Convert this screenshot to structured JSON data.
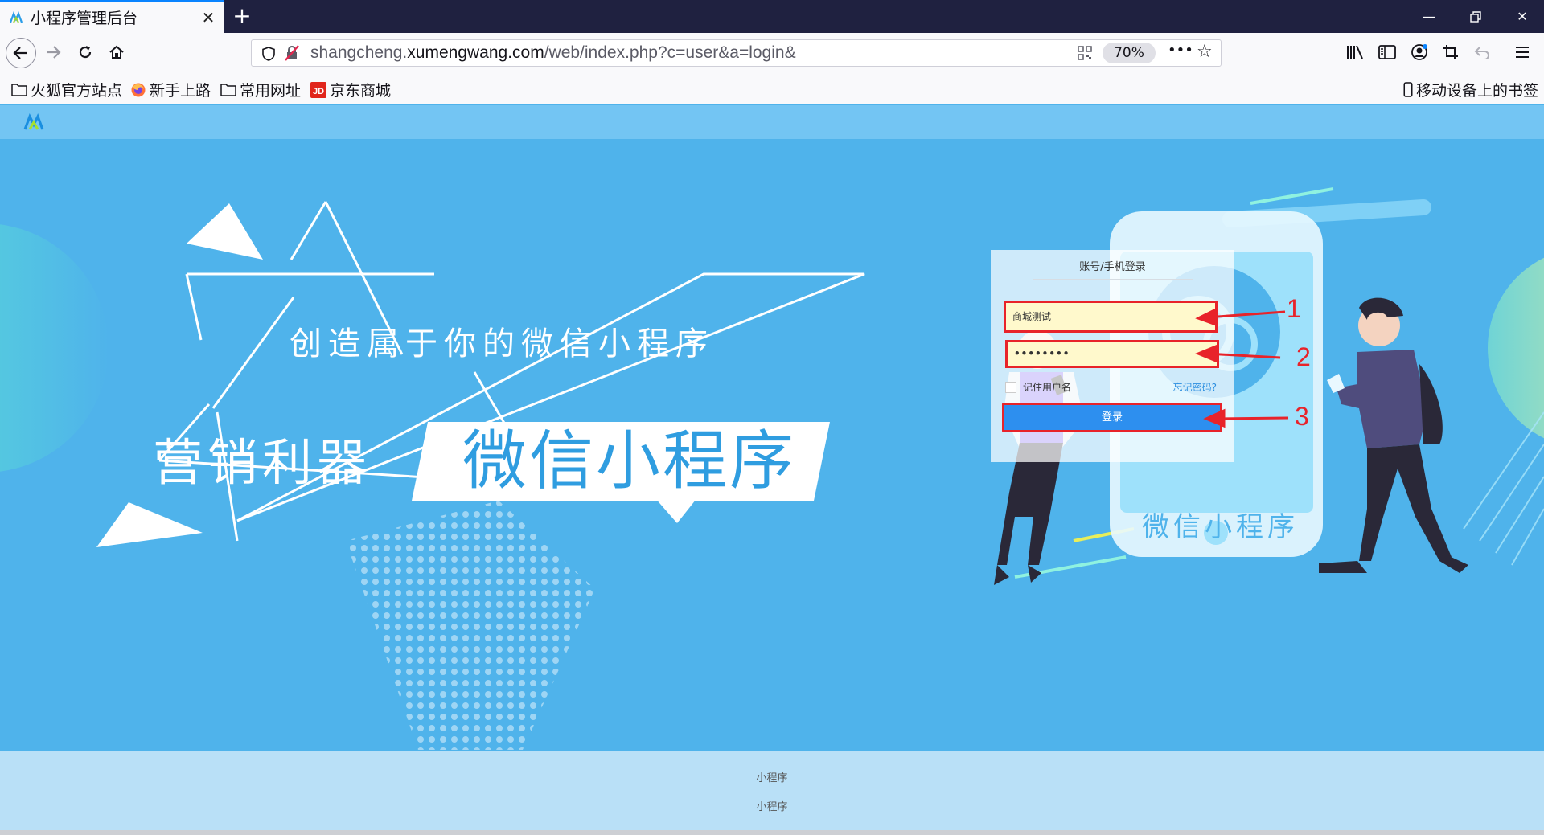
{
  "browser": {
    "tab_title": "小程序管理后台",
    "tab_close": "✕",
    "new_tab": "+",
    "url_host_prefix": "shangcheng.",
    "url_host_main": "xumengwang.com",
    "url_path": "/web/index.php?c=user&a=login&",
    "zoom": "70%",
    "page_actions": "•••"
  },
  "bookmarks": {
    "items": [
      "火狐官方站点",
      "新手上路",
      "常用网址",
      "京东商城"
    ],
    "mobile": "移动设备上的书签"
  },
  "hero": {
    "slogan": "创造属于你的微信小程序",
    "left_title": "营销利器",
    "banner_title": "微信小程序",
    "phone_caption": "微信小程序"
  },
  "login": {
    "title": "账号/手机登录",
    "username_value": "商城测试",
    "password_value": "••••••••",
    "remember_label": "记住用户名",
    "forgot_label": "忘记密码?",
    "submit_label": "登录"
  },
  "annotations": [
    "1",
    "2",
    "3"
  ],
  "footer": {
    "line1": "小程序",
    "line2": "小程序"
  },
  "colors": {
    "hero_bg": "#4fb3eb",
    "annotation_red": "#e8232a",
    "button_blue": "#2d8fef"
  }
}
